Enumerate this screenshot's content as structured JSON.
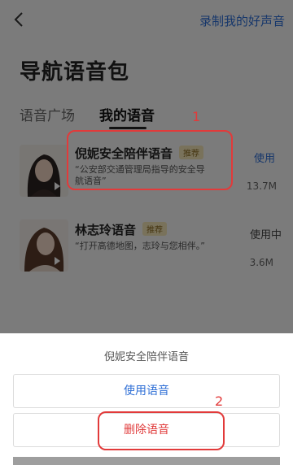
{
  "header": {
    "record_link": "录制我的好声音"
  },
  "page_title": "导航语音包",
  "tabs": [
    {
      "label": "语音广场"
    },
    {
      "label": "我的语音"
    }
  ],
  "voices": [
    {
      "name": "倪妮安全陪伴语音",
      "badge": "推荐",
      "description": "“公安部交通管理局指导的安全导航语音”",
      "action": "使用",
      "size": "13.7M"
    },
    {
      "name": "林志玲语音",
      "badge": "推荐",
      "description": "“打开高德地图，志玲与您相伴。”",
      "action": "使用中",
      "size": "3.6M"
    }
  ],
  "annotations": {
    "marker1": "1",
    "marker2": "2",
    "color": "#e23a3a"
  },
  "action_sheet": {
    "title": "倪妮安全陪伴语音",
    "use_label": "使用语音",
    "delete_label": "删除语音"
  },
  "colors": {
    "accent": "#2f6fd6",
    "danger": "#e03b3b"
  }
}
